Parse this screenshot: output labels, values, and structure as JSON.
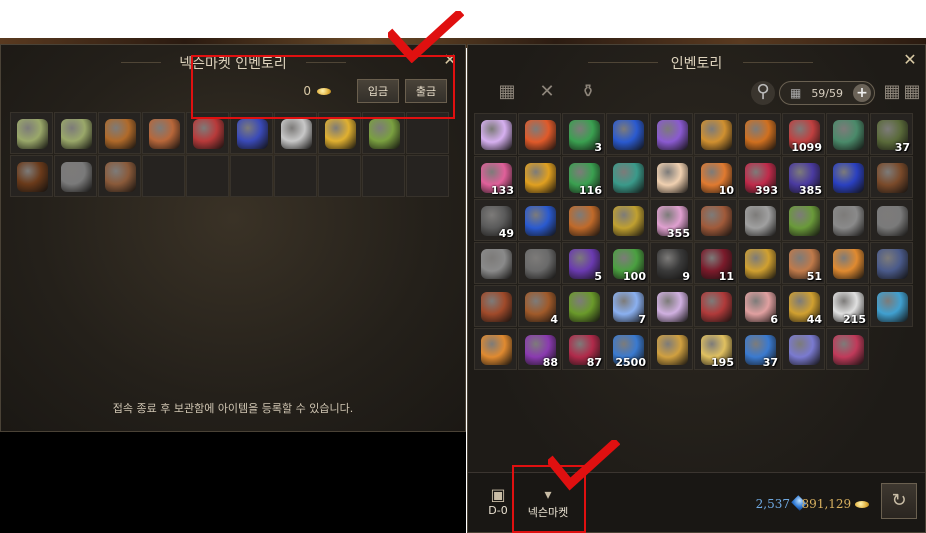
{
  "left_panel": {
    "title": "넥슨마켓 인벤토리",
    "balance": "0",
    "deposit_label": "입금",
    "withdraw_label": "출금",
    "notice": "접속 종료 후 보관함에 아이템을 등록할 수 있습니다.",
    "items": [
      {
        "icon": "scroll-map-icon",
        "color": "#9aa86a"
      },
      {
        "icon": "scroll-map-icon",
        "color": "#9aa86a"
      },
      {
        "icon": "torch-icon",
        "color": "#b06a2a"
      },
      {
        "icon": "book-brown-icon",
        "color": "#b8673a"
      },
      {
        "icon": "book-red-icon",
        "color": "#b83a3a"
      },
      {
        "icon": "book-blue-icon",
        "color": "#3a4ab8"
      },
      {
        "icon": "scissors-icon",
        "color": "#c8c8c8"
      },
      {
        "icon": "yellow-suit-icon",
        "color": "#e0b030"
      },
      {
        "icon": "book-green-icon",
        "color": "#7aa040"
      },
      {
        "icon": "empty",
        "color": ""
      },
      {
        "icon": "stick-icon",
        "color": "#6a3a1a"
      },
      {
        "icon": "shovel-icon",
        "color": "#7a7a7a"
      },
      {
        "icon": "pickaxe-icon",
        "color": "#8a5a3a"
      }
    ]
  },
  "right_panel": {
    "title": "인벤토리",
    "capacity": "59/59",
    "diamonds": "2,537",
    "gold": "891,129",
    "tab_left_icons": [
      "grid-icon",
      "crossed-tools-icon",
      "potion-bottle-icon"
    ],
    "items": [
      {
        "icon": "sparkle-icon",
        "color": "#d6b0f0",
        "qty": ""
      },
      {
        "icon": "red-feather-icon",
        "color": "#e05a2a",
        "qty": ""
      },
      {
        "icon": "green-potion-icon",
        "color": "#3aa050",
        "qty": "3"
      },
      {
        "icon": "blue-scroll-icon",
        "color": "#2a5ad0",
        "qty": ""
      },
      {
        "icon": "purple-feather-icon",
        "color": "#8a5ad0",
        "qty": ""
      },
      {
        "icon": "gold-ring-icon",
        "color": "#d09030",
        "qty": ""
      },
      {
        "icon": "orange-ring-icon",
        "color": "#d07020",
        "qty": ""
      },
      {
        "icon": "mushroom-icon",
        "color": "#c04040",
        "qty": "1099"
      },
      {
        "icon": "green-orb-icon",
        "color": "#4a8a6a",
        "qty": ""
      },
      {
        "icon": "dark-wand-icon",
        "color": "#5a6a3a",
        "qty": "37"
      },
      {
        "icon": "pink-potion-icon",
        "color": "#e0609a",
        "qty": "133"
      },
      {
        "icon": "flame-sword-icon",
        "color": "#e0a020",
        "qty": ""
      },
      {
        "icon": "green-potion-icon",
        "color": "#3aa050",
        "qty": "116"
      },
      {
        "icon": "green-whistle-icon",
        "color": "#3a9a8a",
        "qty": ""
      },
      {
        "icon": "pearl-icon",
        "color": "#f0d0b0",
        "qty": ""
      },
      {
        "icon": "orange-mushroom-icon",
        "color": "#e07a30",
        "qty": "10"
      },
      {
        "icon": "red-bottle-icon",
        "color": "#c02a4a",
        "qty": "393"
      },
      {
        "icon": "blue-beetle-icon",
        "color": "#4a3aa0",
        "qty": "385"
      },
      {
        "icon": "blue-gem-icon",
        "color": "#2a40c0",
        "qty": ""
      },
      {
        "icon": "chest-icon",
        "color": "#7a4a2a",
        "qty": ""
      },
      {
        "icon": "grey-horn-icon",
        "color": "#5a5a5a",
        "qty": "49"
      },
      {
        "icon": "blue-scroll-icon",
        "color": "#2a5ad0",
        "qty": ""
      },
      {
        "icon": "belt-icon",
        "color": "#c06a2a",
        "qty": ""
      },
      {
        "icon": "gold-chain-icon",
        "color": "#c0a030",
        "qty": ""
      },
      {
        "icon": "fairy-doll-icon",
        "color": "#e0a0d0",
        "qty": "355"
      },
      {
        "icon": "old-map-icon",
        "color": "#a05a3a",
        "qty": ""
      },
      {
        "icon": "silver-chain-icon",
        "color": "#a0a0a0",
        "qty": ""
      },
      {
        "icon": "green-eye-icon",
        "color": "#6a9a3a",
        "qty": ""
      },
      {
        "icon": "sickle-icon",
        "color": "#8a8a8a",
        "qty": ""
      },
      {
        "icon": "robot-icon",
        "color": "#7a7a7a",
        "qty": ""
      },
      {
        "icon": "machine-icon",
        "color": "#8a8a8a",
        "qty": ""
      },
      {
        "icon": "black-whistle-icon",
        "color": "#6a6a6a",
        "qty": ""
      },
      {
        "icon": "purple-bat-icon",
        "color": "#6a3ab0",
        "qty": "5"
      },
      {
        "icon": "green-worm-icon",
        "color": "#4aa040",
        "qty": "100"
      },
      {
        "icon": "black-cat-icon",
        "color": "#3a3a3a",
        "qty": "9"
      },
      {
        "icon": "dark-bomb-icon",
        "color": "#7a1a2a",
        "qty": "11"
      },
      {
        "icon": "gold-lamp-icon",
        "color": "#d0a030",
        "qty": ""
      },
      {
        "icon": "pouch-icon",
        "color": "#c07a4a",
        "qty": "51"
      },
      {
        "icon": "candle-icon",
        "color": "#e08a30",
        "qty": ""
      },
      {
        "icon": "totem-icon",
        "color": "#4a5a8a",
        "qty": ""
      },
      {
        "icon": "red-book-icon",
        "color": "#a04a2a",
        "qty": ""
      },
      {
        "icon": "bronze-statue-icon",
        "color": "#a05a2a",
        "qty": "4"
      },
      {
        "icon": "green-necklace-icon",
        "color": "#6a9a2a",
        "qty": ""
      },
      {
        "icon": "snowflake-icon",
        "color": "#8ab0f0",
        "qty": "7"
      },
      {
        "icon": "angel-doll-icon",
        "color": "#d0b0e0",
        "qty": ""
      },
      {
        "icon": "red-tome-icon",
        "color": "#b03a3a",
        "qty": ""
      },
      {
        "icon": "cake-icon",
        "color": "#e0a0a0",
        "qty": "6"
      },
      {
        "icon": "gold-conch-icon",
        "color": "#d0a030",
        "qty": "44"
      },
      {
        "icon": "yinyang-icon",
        "color": "#e0e0e0",
        "qty": "215"
      },
      {
        "icon": "party-horn-icon",
        "color": "#40a0d0",
        "qty": ""
      },
      {
        "icon": "orange-wand-icon",
        "color": "#e08a30",
        "qty": ""
      },
      {
        "icon": "purple-bar-icon",
        "color": "#8a3ab0",
        "qty": "88"
      },
      {
        "icon": "red-bar-icon",
        "color": "#b02a4a",
        "qty": "87"
      },
      {
        "icon": "blue-crystal-icon",
        "color": "#3a7ad0",
        "qty": "2500"
      },
      {
        "icon": "magnifier-icon",
        "color": "#d0a040",
        "qty": ""
      },
      {
        "icon": "yellow-conch-icon",
        "color": "#e0c060",
        "qty": "195"
      },
      {
        "icon": "blue-crystal-icon",
        "color": "#3a7ad0",
        "qty": "37"
      },
      {
        "icon": "eye-orb-icon",
        "color": "#7a7ad0",
        "qty": ""
      },
      {
        "icon": "crimson-cube-icon",
        "color": "#c03a5a",
        "qty": ""
      }
    ]
  },
  "footer_tabs": [
    {
      "icon": "briefcase-icon",
      "label": "D-0"
    },
    {
      "icon": "market-bag-icon",
      "label": "넥슨마켓"
    }
  ]
}
